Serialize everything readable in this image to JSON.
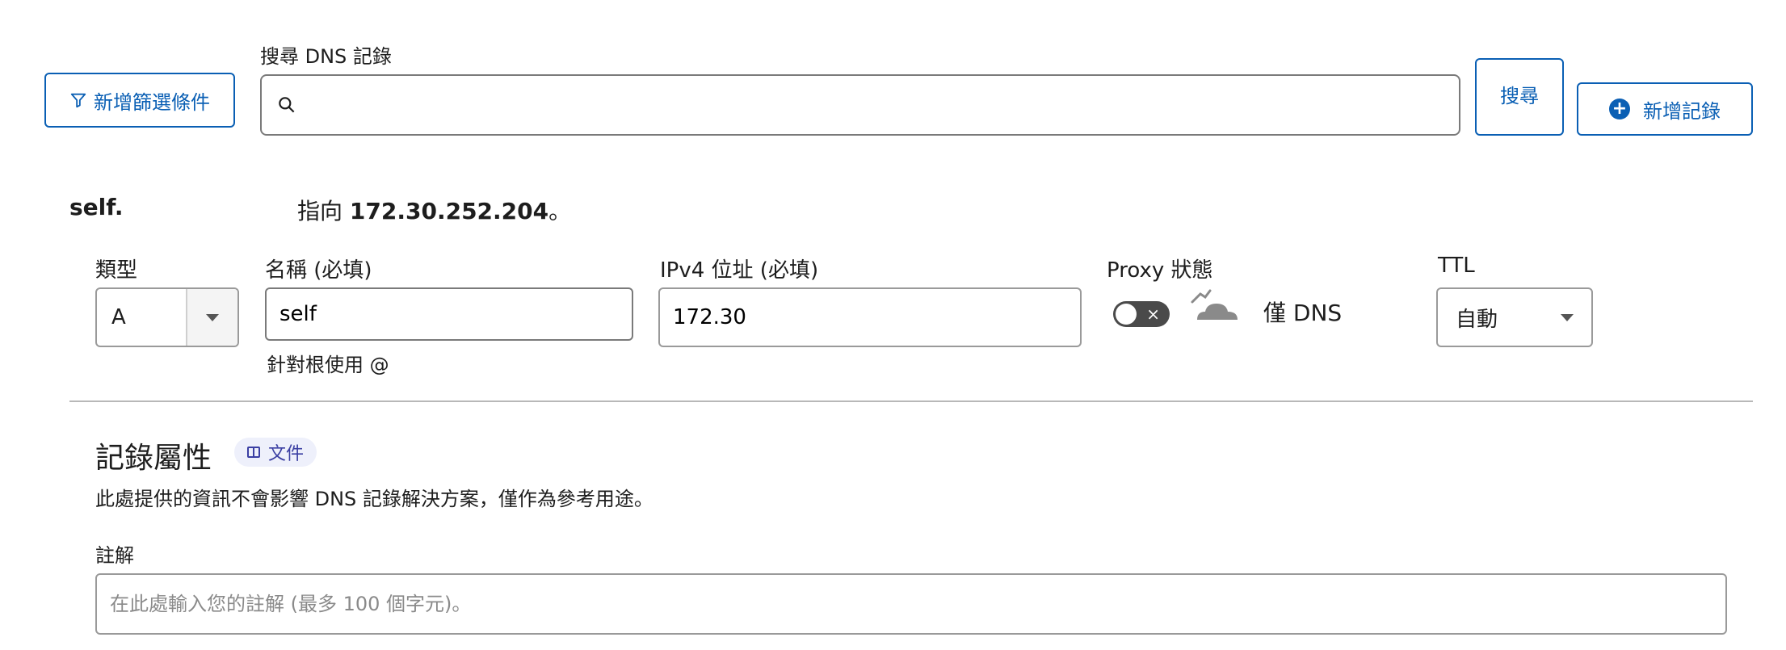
{
  "toolbar": {
    "filter_label": "新增篩選條件",
    "search_label": "搜尋 DNS 記錄",
    "search_value": "",
    "search_button": "搜尋",
    "add_record_button": "新增記錄",
    "accent": "#0a5fb4"
  },
  "record": {
    "name": "self.",
    "points_prefix": "指向 ",
    "points_ip": "172.30.252.204",
    "points_suffix": "。"
  },
  "fields": {
    "type_label": "類型",
    "type_value": "A",
    "name_label": "名稱 (必填)",
    "name_value": "self",
    "name_hint": "針對根使用 @",
    "ipv4_label": "IPv4 位址 (必填)",
    "ipv4_value": "172.30",
    "proxy_label": "Proxy 狀態",
    "proxy_on": false,
    "proxy_text": "僅 DNS",
    "ttl_label": "TTL",
    "ttl_value": "自動"
  },
  "attributes": {
    "title": "記錄屬性",
    "doc_badge": "文件",
    "description": "此處提供的資訊不會影響 DNS 記錄解決方案，僅作為參考用途。",
    "comment_label": "註解",
    "comment_placeholder": "在此處輸入您的註解 (最多 100 個字元)。"
  }
}
